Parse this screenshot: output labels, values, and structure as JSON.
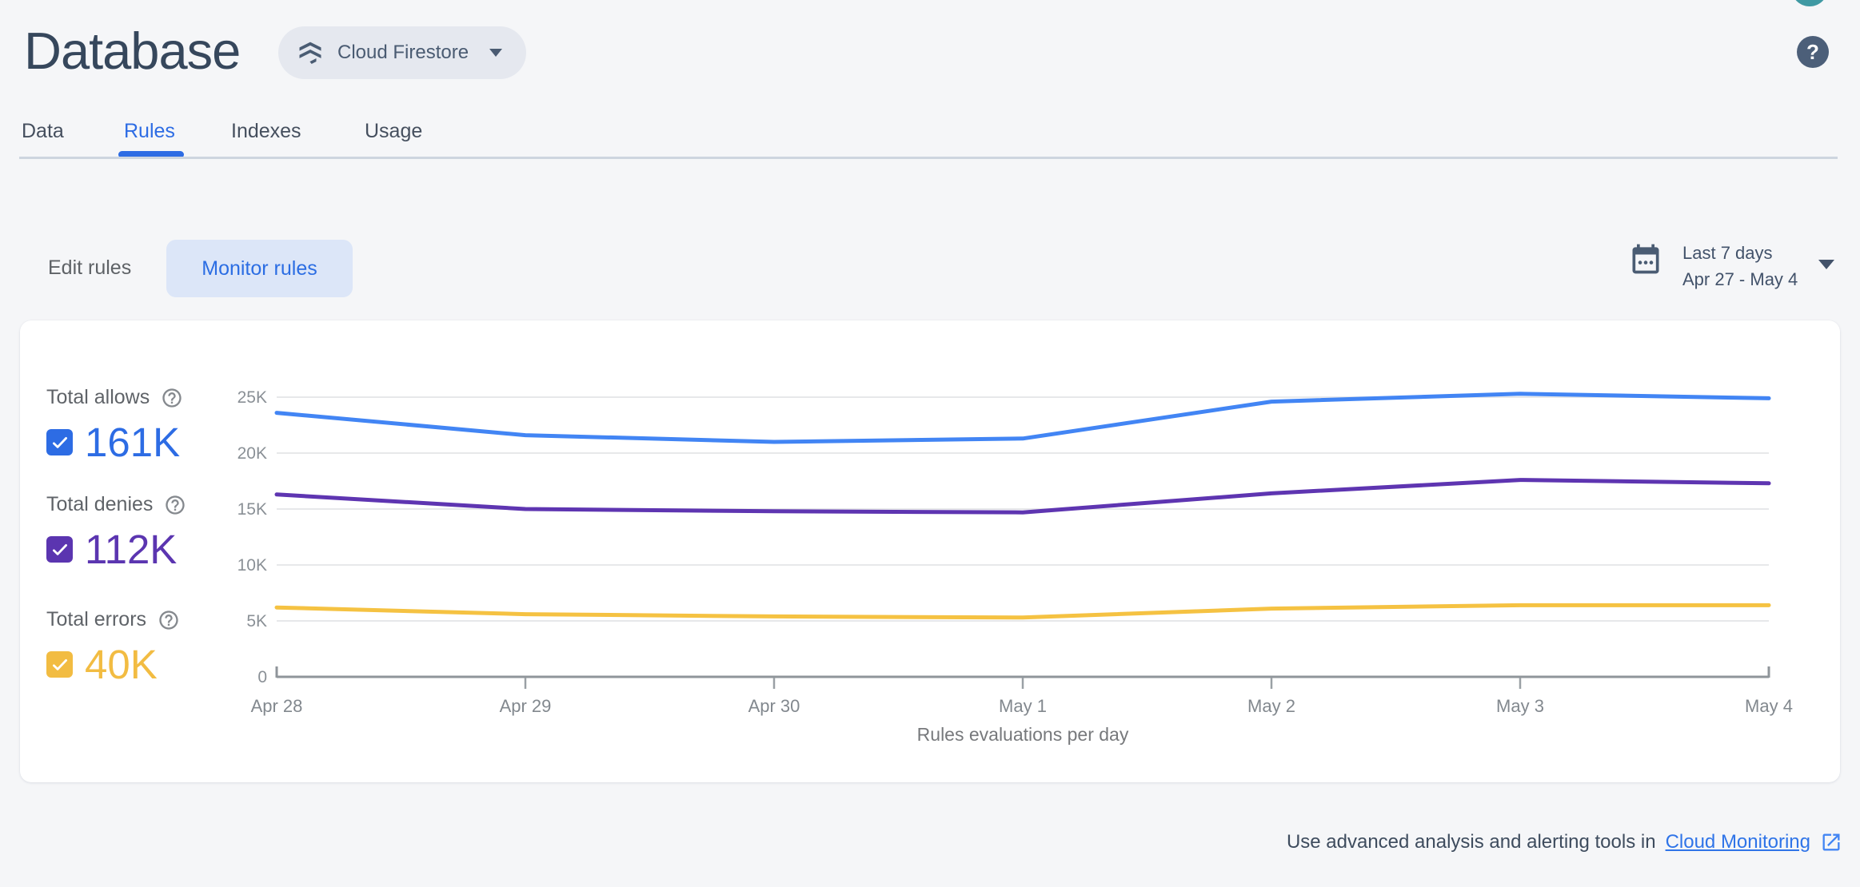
{
  "header": {
    "title": "Database",
    "product_selector_label": "Cloud Firestore",
    "help_glyph": "?"
  },
  "tabs": {
    "items": [
      {
        "label": "Data",
        "active": false
      },
      {
        "label": "Rules",
        "active": true
      },
      {
        "label": "Indexes",
        "active": false
      },
      {
        "label": "Usage",
        "active": false
      }
    ]
  },
  "toolbar": {
    "edit_rules_label": "Edit rules",
    "monitor_rules_label": "Monitor rules",
    "date_range": {
      "line1": "Last 7 days",
      "line2": "Apr 27 - May 4"
    }
  },
  "legend": {
    "items": [
      {
        "label": "Total allows",
        "value": "161K",
        "accent": "#2d6ce4",
        "checked": true
      },
      {
        "label": "Total denies",
        "value": "112K",
        "accent": "#5b35b0",
        "checked": true
      },
      {
        "label": "Total errors",
        "value": "40K",
        "accent": "#f2bc42",
        "checked": true
      }
    ]
  },
  "chart_data": {
    "type": "line",
    "title": "Rules evaluations per day",
    "x_labels": [
      "Apr 28",
      "Apr 29",
      "Apr 30",
      "May 1",
      "May 2",
      "May 3",
      "May 4"
    ],
    "y_ticks": [
      {
        "value": 0,
        "label": "0"
      },
      {
        "value": 5000,
        "label": "5K"
      },
      {
        "value": 10000,
        "label": "10K"
      },
      {
        "value": 15000,
        "label": "15K"
      },
      {
        "value": 20000,
        "label": "20K"
      },
      {
        "value": 25000,
        "label": "25K"
      }
    ],
    "ylim": [
      0,
      25000
    ],
    "grid": true,
    "legend_position": "left",
    "series": [
      {
        "name": "Total allows",
        "total": "161K",
        "color": "#4285f4",
        "values": [
          23600,
          21600,
          21000,
          21300,
          24600,
          25300,
          24900
        ]
      },
      {
        "name": "Total denies",
        "total": "112K",
        "color": "#5e35b1",
        "values": [
          16300,
          15000,
          14800,
          14700,
          16400,
          17600,
          17300
        ]
      },
      {
        "name": "Total errors",
        "total": "40K",
        "color": "#f5c242",
        "values": [
          6200,
          5600,
          5400,
          5300,
          6100,
          6400,
          6400
        ]
      }
    ]
  },
  "footer": {
    "text": "Use advanced analysis and alerting tools in",
    "link_label": "Cloud Monitoring"
  },
  "colors": {
    "accent_blue": "#2d6ce4",
    "accent_purple": "#5b35b0",
    "accent_amber": "#f2bc42",
    "line_blue": "#4285f4",
    "line_purple": "#5e35b1",
    "line_amber": "#f5c242",
    "page_bg": "#f5f6f8",
    "card_bg": "#ffffff"
  }
}
